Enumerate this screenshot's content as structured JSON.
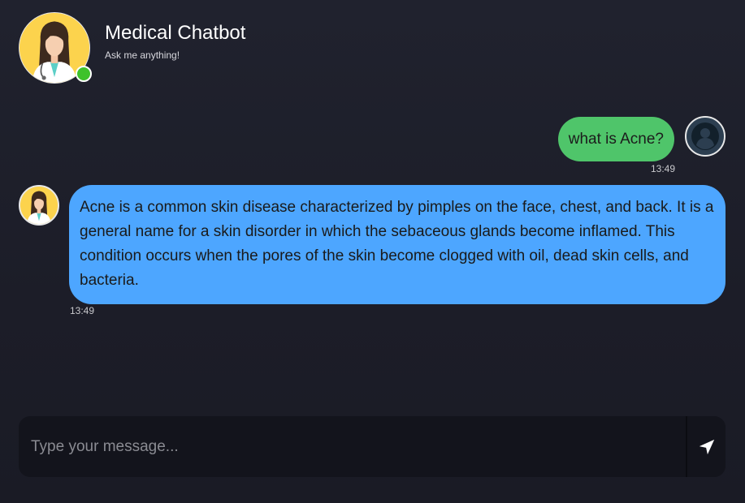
{
  "header": {
    "title": "Medical Chatbot",
    "subtitle": "Ask me anything!"
  },
  "messages": [
    {
      "sender": "user",
      "text": "what is Acne?",
      "time": "13:49"
    },
    {
      "sender": "bot",
      "text": "Acne is a common skin disease characterized by pimples on the face, chest, and back. It is a general name for a skin disorder in which the sebaceous glands become inflamed. This condition occurs when the pores of the skin become clogged with oil, dead skin cells, and bacteria.",
      "time": "13:49"
    }
  ],
  "input": {
    "placeholder": "Type your message..."
  },
  "icons": {
    "bot_avatar": "doctor-avatar-icon",
    "user_avatar": "user-circle-icon",
    "send": "send-arrow-icon",
    "status": "online-status-icon"
  },
  "colors": {
    "user_bubble": "#4fc56a",
    "bot_bubble": "#4da6ff",
    "online": "#3ec22b",
    "background": "#1e1f2b"
  }
}
